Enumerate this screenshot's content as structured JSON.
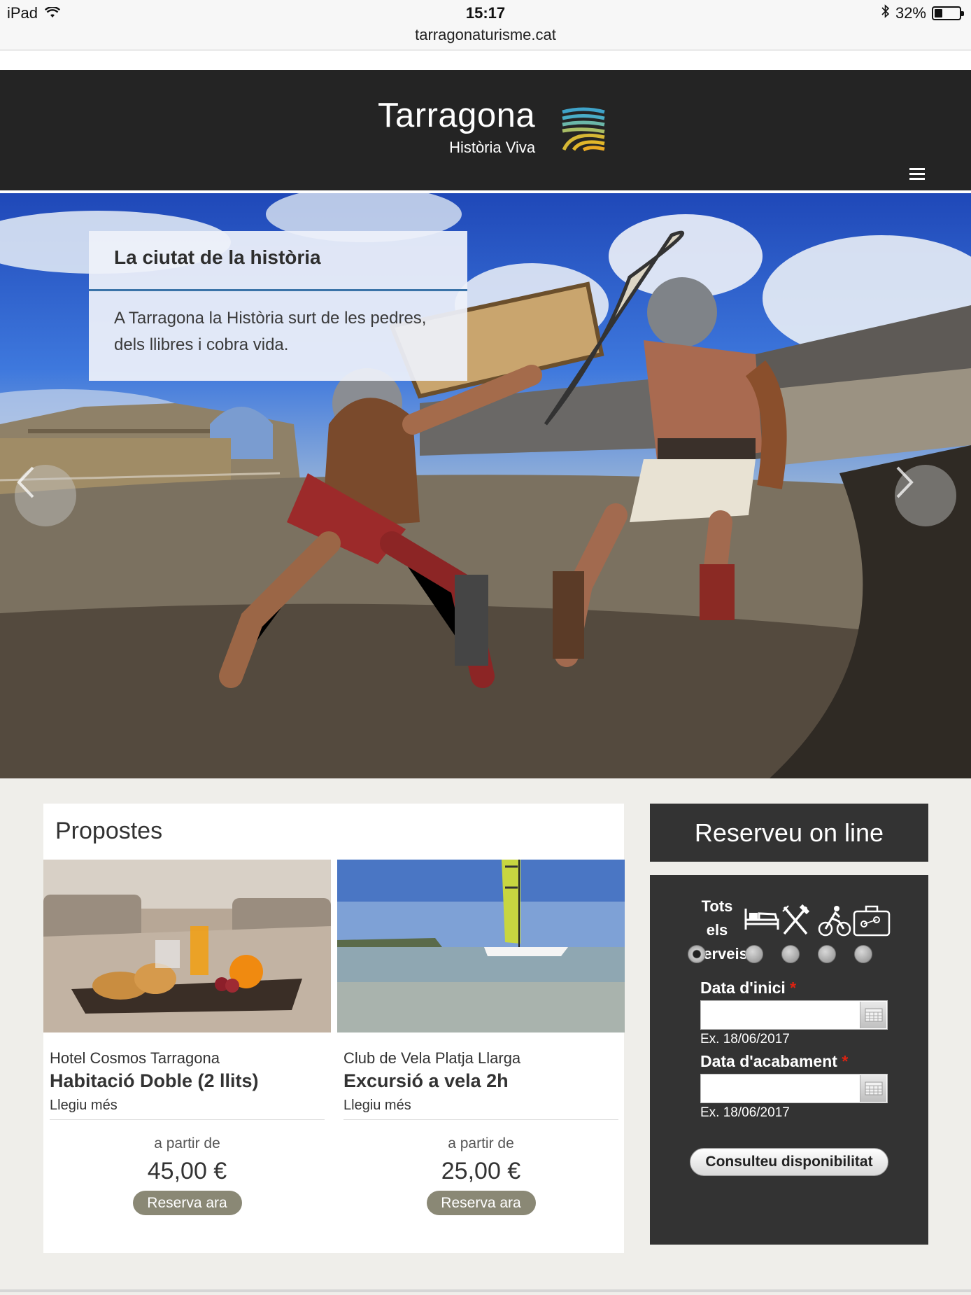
{
  "status_bar": {
    "device": "iPad",
    "time": "15:17",
    "url": "tarragonaturisme.cat",
    "battery": "32%",
    "battery_level": 0.32
  },
  "header": {
    "title": "Tarragona",
    "subtitle": "Història Viva",
    "colors": {
      "background": "#242424",
      "logo_top": "#3fa3c9",
      "logo_bottom": "#e2b72a"
    }
  },
  "hero": {
    "caption_title": "La ciutat de la història",
    "caption_text": "A Tarragona la Història surt de les pedres, dels llibres i cobra vida.",
    "prev_icon": "chevron-left-icon",
    "next_icon": "chevron-right-icon"
  },
  "proposals": {
    "title": "Propostes",
    "items": [
      {
        "provider": "Hotel Cosmos Tarragona",
        "name": "Habitació Doble (2 llits)",
        "more": "Llegiu més",
        "from": "a partir de",
        "price": "45,00 €",
        "button": "Reserva ara"
      },
      {
        "provider": "Club de Vela Platja Llarga",
        "name": "Excursió a vela 2h",
        "more": "Llegiu més",
        "from": "a partir de",
        "price": "25,00 €",
        "button": "Reserva ara"
      }
    ]
  },
  "booking": {
    "title": "Reserveu on line",
    "all_services": "Tots els serveis",
    "service_icons": [
      "bed-icon",
      "cutlery-icon",
      "cyclist-icon",
      "suitcase-icon"
    ],
    "selected_service": "Tots els serveis",
    "start_label": "Data d'inici",
    "start_value": "",
    "start_hint": "Ex. 18/06/2017",
    "end_label": "Data d'acabament",
    "end_value": "",
    "end_hint": "Ex. 18/06/2017",
    "required_mark": "*",
    "submit": "Consulteu disponibilitat"
  }
}
